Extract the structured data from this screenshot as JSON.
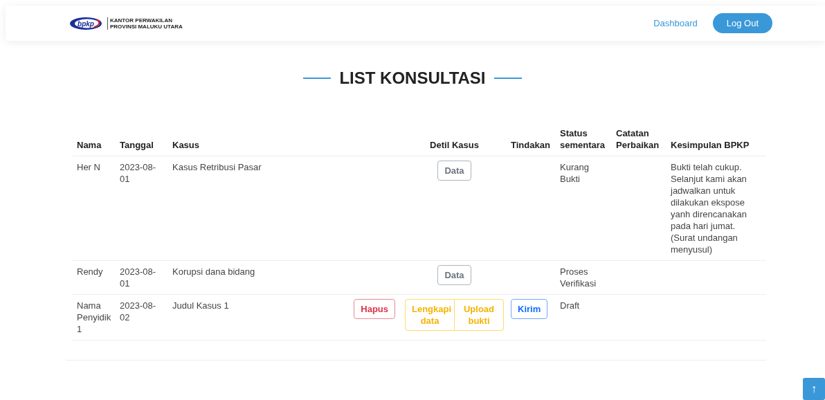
{
  "header": {
    "logo_mark": "bpkp",
    "logo_lines": [
      "KANTOR PERWAKILAN",
      "PROVINSI MALUKU UTARA"
    ],
    "nav_link": "Dashboard",
    "logout_button": "Log Out"
  },
  "title": "LIST KONSULTASI",
  "table": {
    "columns": [
      {
        "label": "Nama"
      },
      {
        "label": "Tanggal"
      },
      {
        "label": "Kasus"
      },
      {
        "label": "Detil Kasus"
      },
      {
        "label": "Tindakan"
      },
      {
        "label": "Status sementara"
      },
      {
        "label": "Catatan Perbaikan"
      },
      {
        "label": "Kesimpulan BPKP"
      }
    ],
    "rows": [
      {
        "name": "Her N",
        "date": "2023-08-01",
        "case": "Kasus Retribusi Pasar",
        "detail_buttons": [
          {
            "label": "Data",
            "kind": "secondary"
          }
        ],
        "status": "Kurang Bukti",
        "conclusion": "Bukti telah cukup. Selanjut kami akan jadwalkan untuk dilakukan ekspose yanh direncanakan pada hari jumat. (Surat undangan menyusul)"
      },
      {
        "name": "Rendy",
        "date": "2023-08-01",
        "case": "Korupsi dana bidang",
        "detail_buttons": [
          {
            "label": "Data",
            "kind": "secondary"
          }
        ],
        "status": "Proses Verifikasi"
      },
      {
        "name": "Nama Penyidik 1",
        "date": "2023-08-02",
        "case": "Judul Kasus 1",
        "delete_button": {
          "label": "Hapus",
          "kind": "danger"
        },
        "detail_buttons": [
          {
            "label": "Lengkapi data",
            "kind": "warning"
          },
          {
            "label": "Upload bukti",
            "kind": "warning"
          }
        ],
        "action_button": {
          "label": "Kirim",
          "kind": "primary"
        },
        "status": "Draft"
      }
    ]
  },
  "scroll_top_button": "↑"
}
